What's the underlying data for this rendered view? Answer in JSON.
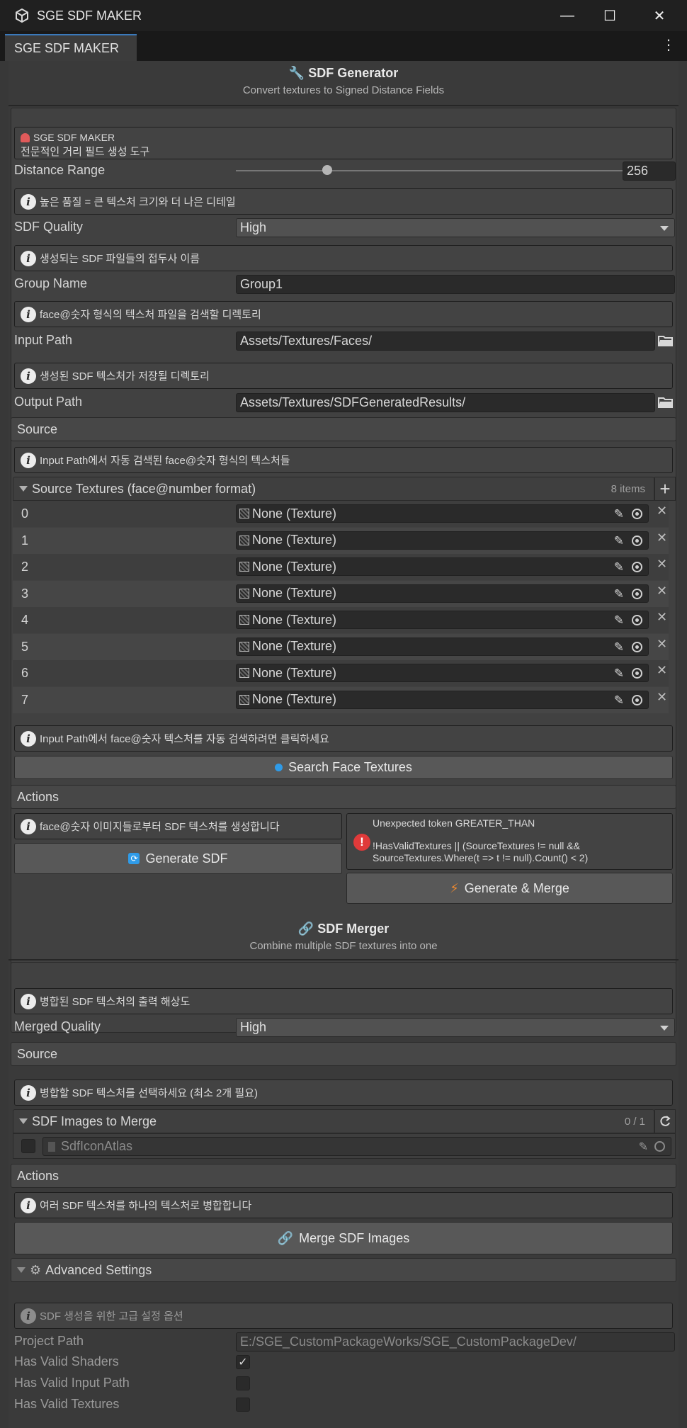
{
  "window": {
    "title": "SGE SDF MAKER",
    "tab_label": "SGE SDF MAKER",
    "minimize_glyph": "—",
    "maximize_glyph": "☐",
    "close_glyph": "✕",
    "menu_glyph": "⋮"
  },
  "generator": {
    "title": "SDF Generator",
    "subtitle": "Convert textures to Signed Distance Fields",
    "banner_title": "SGE SDF MAKER",
    "banner_subtitle": "전문적인 거리 필드 생성 도구",
    "distance_range_label": "Distance Range",
    "distance_range_value": "256",
    "distance_range_fraction": 0.235,
    "quality_info": "높은 품질 = 큰 텍스처 크기와 더 나은 디테일",
    "quality_label": "SDF Quality",
    "quality_value": "High",
    "group_info": "생성되는 SDF 파일들의 접두사 이름",
    "group_label": "Group Name",
    "group_value": "Group1",
    "input_info": "face@숫자 형식의 텍스처 파일을 검색할 디렉토리",
    "input_label": "Input Path",
    "input_value": "Assets/Textures/Faces/",
    "output_info": "생성된 SDF 텍스처가 저장될 디렉토리",
    "output_label": "Output Path",
    "output_value": "Assets/Textures/SDFGeneratedResults/"
  },
  "source": {
    "header": "Source",
    "info": "Input Path에서 자동 검색된 face@숫자 형식의 텍스처들",
    "list_title": "Source Textures (face@number format)",
    "list_count": "8 items",
    "add_glyph": "+",
    "remove_glyph": "✕",
    "items": [
      {
        "index": "0",
        "value": "None (Texture)"
      },
      {
        "index": "1",
        "value": "None (Texture)"
      },
      {
        "index": "2",
        "value": "None (Texture)"
      },
      {
        "index": "3",
        "value": "None (Texture)"
      },
      {
        "index": "4",
        "value": "None (Texture)"
      },
      {
        "index": "5",
        "value": "None (Texture)"
      },
      {
        "index": "6",
        "value": "None (Texture)"
      },
      {
        "index": "7",
        "value": "None (Texture)"
      }
    ],
    "search_info": "Input Path에서 face@숫자 텍스처를 자동 검색하려면 클릭하세요",
    "search_button": "Search Face Textures"
  },
  "actions": {
    "header": "Actions",
    "generate_info": "face@숫자 이미지들로부터 SDF 텍스처를 생성합니다",
    "generate_button": "Generate SDF",
    "error_line1": "Unexpected token GREATER_THAN",
    "error_line2": "!HasValidTextures || (SourceTextures != null &&",
    "error_line3": "SourceTextures.Where(t => t != null).Count() < 2)",
    "generate_merge_button": "Generate & Merge"
  },
  "merger": {
    "title": "SDF Merger",
    "subtitle": "Combine multiple SDF textures into one",
    "quality_info": "병합된 SDF 텍스처의 출력 해상도",
    "quality_label": "Merged Quality",
    "quality_value": "High",
    "source_header": "Source",
    "source_info": "병합할 SDF 텍스처를 선택하세요 (최소 2개 필요)",
    "list_title": "SDF Images to Merge",
    "list_count": "0 / 1",
    "item_value": "SdfIconAtlas",
    "actions_header": "Actions",
    "merge_info": "여러 SDF 텍스처를 하나의 텍스처로 병합합니다",
    "merge_button": "Merge SDF Images"
  },
  "advanced": {
    "header": "Advanced Settings",
    "info": "SDF 생성을 위한 고급 설정 옵션",
    "project_path_label": "Project Path",
    "project_path_value": "E:/SGE_CustomPackageWorks/SGE_CustomPackageDev/",
    "valid_shaders_label": "Has Valid Shaders",
    "valid_shaders": true,
    "valid_input_label": "Has Valid Input Path",
    "valid_input": false,
    "valid_textures_label": "Has Valid Textures",
    "valid_textures": false
  },
  "colors": {
    "accent": "#3a79bb",
    "error": "#e03a3a",
    "lightning": "#f08a30",
    "search_dot": "#2f9be8"
  }
}
